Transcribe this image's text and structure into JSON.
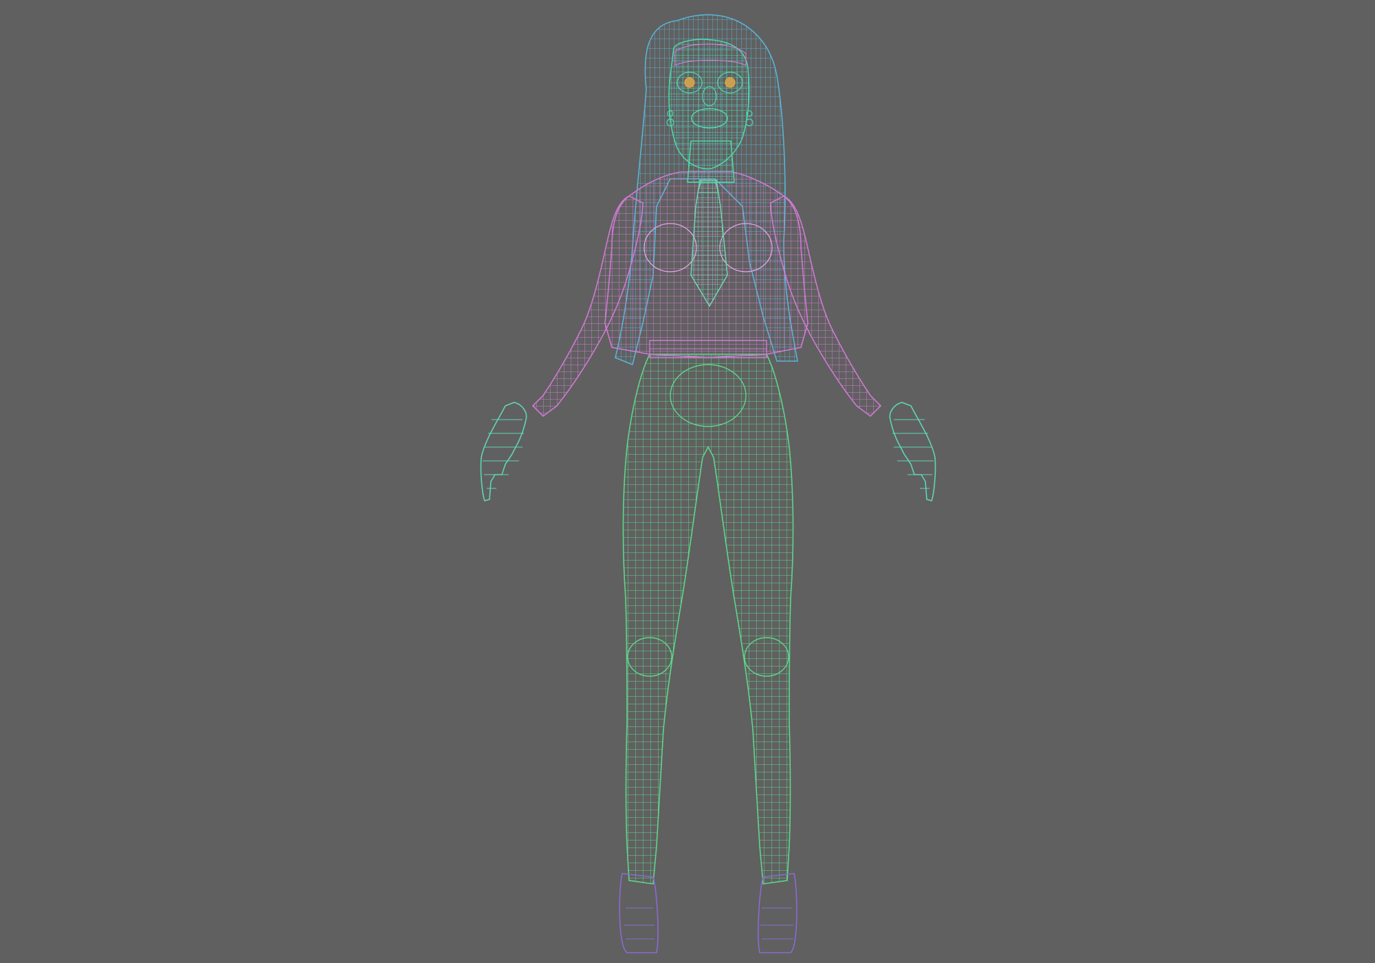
{
  "viewport": {
    "background": "#606060",
    "shading_mode": "wireframe"
  },
  "model": {
    "pose": "A-pose",
    "parts": [
      {
        "name": "hair",
        "color": "#5ab4d6"
      },
      {
        "name": "face",
        "color": "#4fd6a8"
      },
      {
        "name": "top",
        "color": "#d07ad4"
      },
      {
        "name": "tie",
        "color": "#6fd6b0"
      },
      {
        "name": "hands",
        "color": "#5fd6b6"
      },
      {
        "name": "legs",
        "color": "#5fd68a"
      },
      {
        "name": "shoes",
        "color": "#8a6ad4"
      },
      {
        "name": "eyes",
        "color": "#e6a23a"
      }
    ]
  }
}
